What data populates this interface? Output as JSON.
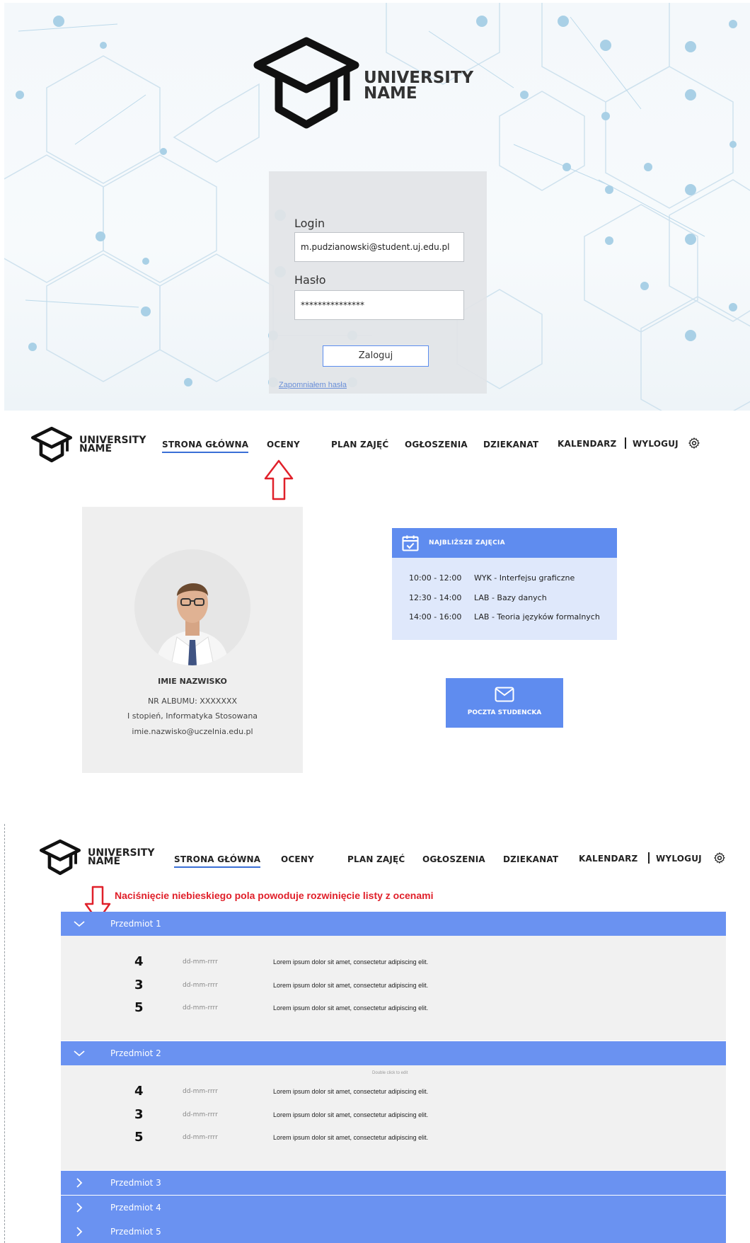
{
  "login": {
    "logo_text_line1": "UNIVERSITY",
    "logo_text_line2": "NAME",
    "login_label": "Login",
    "login_value": "m.pudzianowski@student.uj.edu.pl",
    "password_label": "Hasło",
    "password_value": "***************",
    "submit_label": "Zaloguj",
    "forgot_link": "Zapomniałem hasła"
  },
  "nav": {
    "logo_line1": "UNIVERSITY",
    "logo_line2": "NAME",
    "items": [
      "STRONA GŁÓWNA",
      "OCENY",
      "PLAN ZAJĘĆ",
      "OGŁOSZENIA",
      "DZIEKANAT",
      "KALENDARZ"
    ],
    "logout": "WYLOGUJ"
  },
  "profile": {
    "name": "IMIE NAZWISKO",
    "album": "NR ALBUMU: XXXXXXX",
    "program": "I stopień, Informatyka Stosowana",
    "email": "imie.nazwisko@uczelnia.edu.pl"
  },
  "schedule": {
    "title": "NAJBLIŻSZE ZAJĘCIA",
    "rows": [
      {
        "time": "10:00 - 12:00",
        "course": "WYK - Interfejsu graficzne"
      },
      {
        "time": "12:30 - 14:00",
        "course": "LAB - Bazy danych"
      },
      {
        "time": "14:00 - 16:00",
        "course": "LAB - Teoria języków formalnych"
      }
    ]
  },
  "mail": {
    "label": "POCZTA STUDENCKA"
  },
  "grades": {
    "annotation": "Naciśnięcie niebieskiego pola powoduje rozwinięcie listy z ocenami",
    "double_click_hint": "Double click to edit",
    "subjects": [
      {
        "name": "Przedmiot 1",
        "expanded": true,
        "grades": [
          {
            "value": "4",
            "date": "dd-mm-rrrr",
            "desc": "Lorem ipsum dolor sit amet, consectetur adipiscing elit."
          },
          {
            "value": "3",
            "date": "dd-mm-rrrr",
            "desc": "Lorem ipsum dolor sit amet, consectetur adipiscing elit."
          },
          {
            "value": "5",
            "date": "dd-mm-rrrr",
            "desc": "Lorem ipsum dolor sit amet, consectetur adipiscing elit."
          }
        ]
      },
      {
        "name": "Przedmiot 2",
        "expanded": true,
        "grades": [
          {
            "value": "4",
            "date": "dd-mm-rrrr",
            "desc": "Lorem ipsum dolor sit amet, consectetur adipiscing elit."
          },
          {
            "value": "3",
            "date": "dd-mm-rrrr",
            "desc": "Lorem ipsum dolor sit amet, consectetur adipiscing elit."
          },
          {
            "value": "5",
            "date": "dd-mm-rrrr",
            "desc": "Lorem ipsum dolor sit amet, consectetur adipiscing elit."
          }
        ]
      },
      {
        "name": "Przedmiot 3",
        "expanded": false
      },
      {
        "name": "Przedmiot 4",
        "expanded": false
      },
      {
        "name": "Przedmiot 5",
        "expanded": false
      }
    ]
  },
  "colors": {
    "accent": "#5f8cef",
    "subject_bar": "#6a92f1",
    "annotation": "#e0202a"
  }
}
